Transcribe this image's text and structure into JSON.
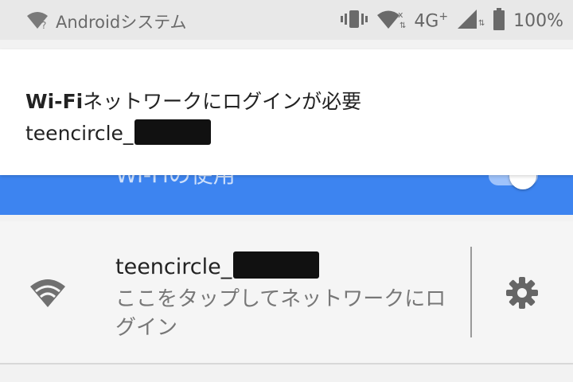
{
  "status_bar": {
    "app_name": "Androidシステム",
    "network_type": "4G",
    "network_plus": "+",
    "battery_percent": "100%",
    "icons": [
      "wifi-question-icon",
      "vibrate-icon",
      "wifi-signal-icon",
      "cell-signal-icon",
      "battery-icon"
    ]
  },
  "notification": {
    "title_bold": "Wi-Fi",
    "title_rest": "ネットワークにログインが必要",
    "ssid_prefix": "teencircle_"
  },
  "wifi_header": {
    "title": "Wi-Fiの使用",
    "toggle_on": true
  },
  "network": {
    "ssid_prefix": "teencircle_",
    "subtitle": "ここをタップしてネットワークにログイン",
    "icons": [
      "wifi-signal-icon",
      "gear-icon"
    ]
  },
  "colors": {
    "accent_blue": "#3d84f0",
    "status_bg": "#e8e8e8"
  }
}
